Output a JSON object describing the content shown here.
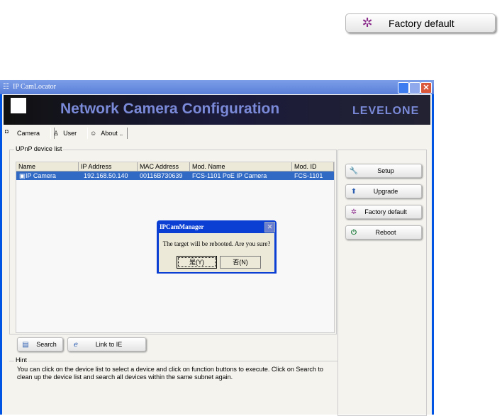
{
  "top_button": {
    "label": "Factory default",
    "icon": "spinner-icon"
  },
  "window": {
    "title": "IP CamLocator",
    "banner_title": "Network Camera Configuration",
    "brand": "LEVELONE",
    "logo_text": "level one"
  },
  "tabs": [
    {
      "label": "Camera",
      "active": true
    },
    {
      "label": "User"
    },
    {
      "label": "About .."
    }
  ],
  "device_list": {
    "group_label": "UPnP device list",
    "columns": [
      "Name",
      "IP Address",
      "MAC Address",
      "Mod. Name",
      "Mod. ID"
    ],
    "rows": [
      {
        "name": "IP Camera",
        "ip": "192.168.50.140",
        "mac": "00116B730639",
        "mod_name": "FCS-1101 PoE IP Camera",
        "mod_id": "FCS-1101",
        "selected": true
      }
    ]
  },
  "side_buttons": [
    {
      "label": "Setup",
      "icon": "wrench-icon"
    },
    {
      "label": "Upgrade",
      "icon": "upgrade-icon"
    },
    {
      "label": "Factory default",
      "icon": "spinner-icon"
    },
    {
      "label": "Reboot",
      "icon": "power-icon"
    }
  ],
  "bottom_buttons": {
    "search": "Search",
    "link": "Link to IE"
  },
  "hint": {
    "label": "Hint",
    "text": "You can click on the device list to select a device and click on function buttons to execute. Click on Search to clean up the device list and search all devices  within the same subnet again."
  },
  "dialog": {
    "title": "IPCamManager",
    "message": "The target will be rebooted. Are you sure?",
    "yes": "是(Y)",
    "no": "否(N)"
  },
  "colors": {
    "selection": "#316ac5",
    "titlebar": "#5a7fd8"
  }
}
